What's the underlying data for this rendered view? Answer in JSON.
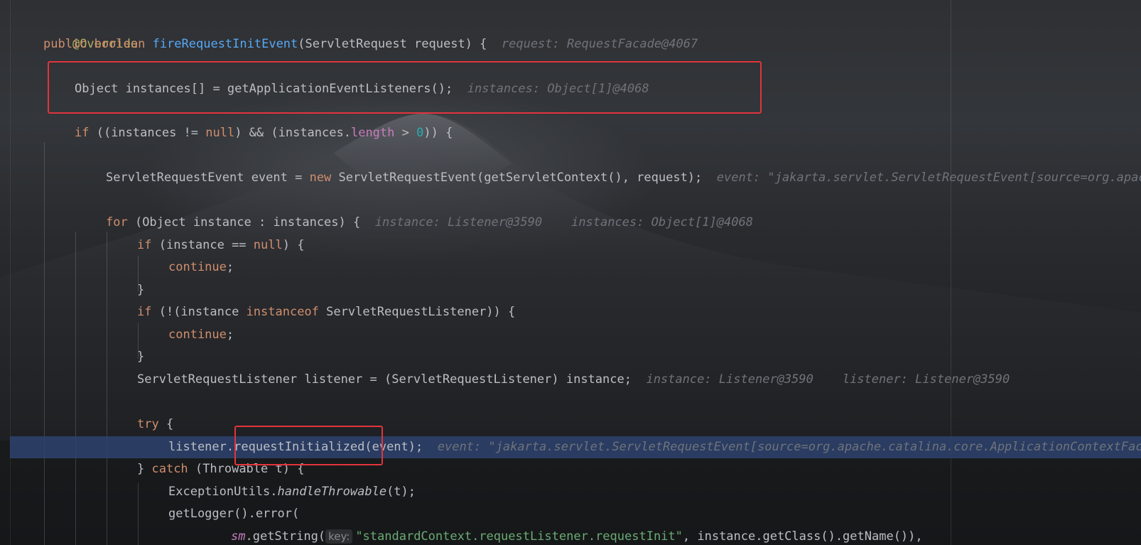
{
  "editor": {
    "lines": {
      "l1": {
        "annotation": "@Override"
      },
      "l2": {
        "kw1": "public",
        "kw2": "boolean",
        "method": "fireRequestInitEvent",
        "rest": "(ServletRequest request) {",
        "hint": "request: RequestFacade@4067"
      },
      "l3": {
        "code": "Object instances[] = getApplicationEventListeners();",
        "hint": "instances: Object[1]@4068"
      },
      "l4": {
        "kw": "if",
        "p1": " ((instances != ",
        "nullkw": "null",
        "p2": ") && (instances.",
        "field": "length",
        "p3": " > ",
        "num": "0",
        "p4": ")) {"
      },
      "l5": {
        "p1": "ServletRequestEvent event = ",
        "kw": "new",
        "p2": " ServletRequestEvent(getServletContext(), request);",
        "hint": "event: \"jakarta.servlet.ServletRequestEvent[source=org.apache.catalina.core.ApplicationContextFacade@"
      },
      "l6": {
        "kw": "for",
        "p1": " (Object instance : instances) {",
        "hint1": "instance: Listener@3590",
        "hint2": "instances: Object[1]@4068"
      },
      "l7": {
        "kw": "if",
        "p1": " (instance == ",
        "nullkw": "null",
        "p2": ") {"
      },
      "l8": {
        "kw": "continue",
        "p1": ";"
      },
      "l9": {
        "p1": "}"
      },
      "l10": {
        "kw": "if",
        "p1": " (!(instance ",
        "kw2": "instanceof",
        "p2": " ServletRequestListener)) {"
      },
      "l11": {
        "kw": "continue",
        "p1": ";"
      },
      "l12": {
        "p1": "}"
      },
      "l13": {
        "p1": "ServletRequestListener listener = (ServletRequestListener) instance;",
        "hint1": "instance: Listener@3590",
        "hint2": "listener: Listener@3590"
      },
      "l14": {
        "kw": "try",
        "p1": " {"
      },
      "l15": {
        "p1": "listener.",
        "method": "requestInitialized",
        "p2": "(event);",
        "hint": "event: \"jakarta.servlet.ServletRequestEvent[source=org.apache.catalina.core.ApplicationContextFacade@"
      },
      "l16": {
        "p1": "} ",
        "kw": "catch",
        "p2": " (Throwable t) {"
      },
      "l17": {
        "p1": "ExceptionUtils.",
        "method": "handleThrowable",
        "p2": "(t);"
      },
      "l18": {
        "p1": "getLogger().error("
      },
      "l19": {
        "field": "sm",
        "p1": ".getString(",
        "param": "key:",
        "str": "\"standardContext.requestListener.requestInit\"",
        "p2": ", instance.getClass().getName()),"
      }
    }
  },
  "colors": {
    "keyword": "#cf8e6d",
    "annotation": "#b3ae60",
    "method_decl": "#56a8f5",
    "number": "#2aacb8",
    "field": "#c77dbb",
    "string": "#6aab73",
    "inlay_hint": "#6f737a",
    "current_line": "#2e436e",
    "highlight_box": "#e0353b"
  }
}
